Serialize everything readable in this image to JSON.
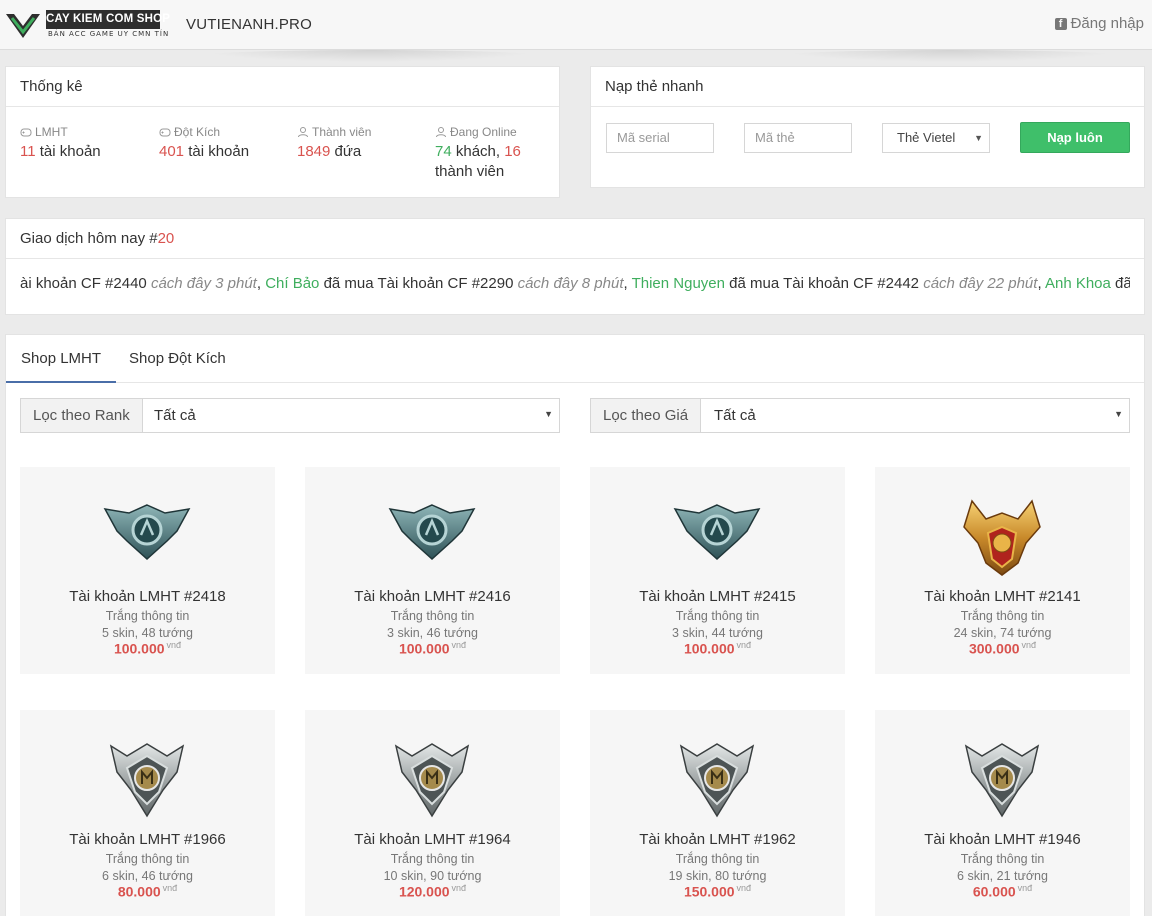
{
  "header": {
    "logo_title": "CAY KIEM COM SHOP",
    "logo_sub": "BÁN ACC GAME UY CMN TÍN",
    "brand": "VUTIENANH.PRO",
    "login_label": "Đăng nhập"
  },
  "stats": {
    "title": "Thống kê",
    "items": [
      {
        "label": "LMHT",
        "num": "11",
        "suffix": " tài khoản",
        "icon": "gamepad-icon"
      },
      {
        "label": "Đột Kích",
        "num": "401",
        "suffix": " tài khoản",
        "icon": "gamepad-icon"
      },
      {
        "label": "Thành viên",
        "num": "1849",
        "suffix": " đứa",
        "icon": "users-icon"
      },
      {
        "label": "Đang Online",
        "num": "74",
        "mid": " khách, ",
        "num2": "16",
        "suffix": " thành viên",
        "icon": "users-icon"
      }
    ]
  },
  "topup": {
    "title": "Nạp thẻ nhanh",
    "serial_placeholder": "Mã serial",
    "code_placeholder": "Mã thẻ",
    "carrier_selected": "Thẻ Vietel",
    "submit_label": "Nạp luôn"
  },
  "transactions": {
    "title_prefix": "Giao dịch hôm nay #",
    "count": "20",
    "entries": [
      {
        "buyer": "",
        "text": "ài khoản CF #2440",
        "ago": "cách đây 3 phút"
      },
      {
        "buyer": "Chí Bảo",
        "text": "đã mua Tài khoản CF #2290",
        "ago": "cách đây 8 phút"
      },
      {
        "buyer": "Thien Nguyen",
        "text": "đã mua Tài khoản CF #2442",
        "ago": "cách đây 22 phút"
      },
      {
        "buyer": "Anh Khoa",
        "text": "đã mua Tài",
        "ago": ""
      }
    ]
  },
  "shop": {
    "tabs": [
      "Shop LMHT",
      "Shop Đột Kích"
    ],
    "filter_rank_label": "Lọc theo Rank",
    "filter_rank_value": "Tất cả",
    "filter_price_label": "Lọc theo Giá",
    "filter_price_value": "Tất cả",
    "currency": "vnđ",
    "products": [
      {
        "title": "Tài khoản LMHT #2418",
        "info": "Trắng thông tin",
        "detail": "5 skin, 48 tướng",
        "price": "100.000",
        "rank": "platinum"
      },
      {
        "title": "Tài khoản LMHT #2416",
        "info": "Trắng thông tin",
        "detail": "3 skin, 46 tướng",
        "price": "100.000",
        "rank": "platinum"
      },
      {
        "title": "Tài khoản LMHT #2415",
        "info": "Trắng thông tin",
        "detail": "3 skin, 44 tướng",
        "price": "100.000",
        "rank": "platinum"
      },
      {
        "title": "Tài khoản LMHT #2141",
        "info": "Trắng thông tin",
        "detail": "24 skin, 74 tướng",
        "price": "300.000",
        "rank": "gold"
      },
      {
        "title": "Tài khoản LMHT #1966",
        "info": "Trắng thông tin",
        "detail": "6 skin, 46 tướng",
        "price": "80.000",
        "rank": "silver"
      },
      {
        "title": "Tài khoản LMHT #1964",
        "info": "Trắng thông tin",
        "detail": "10 skin, 90 tướng",
        "price": "120.000",
        "rank": "silver"
      },
      {
        "title": "Tài khoản LMHT #1962",
        "info": "Trắng thông tin",
        "detail": "19 skin, 80 tướng",
        "price": "150.000",
        "rank": "silver"
      },
      {
        "title": "Tài khoản LMHT #1946",
        "info": "Trắng thông tin",
        "detail": "6 skin, 21 tướng",
        "price": "60.000",
        "rank": "silver"
      }
    ]
  },
  "colors": {
    "accent_red": "#d9534f",
    "accent_green": "#3fae5e",
    "button_green": "#3fbf6a",
    "tab_underline": "#4a6ea8"
  }
}
